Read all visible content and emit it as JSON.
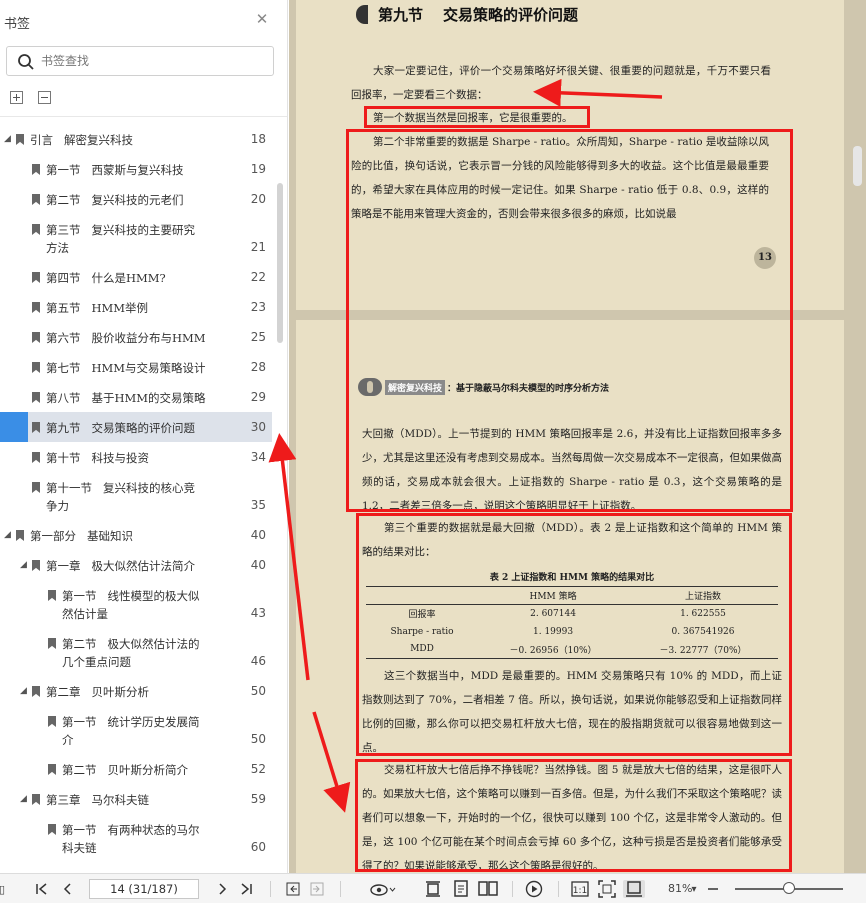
{
  "sidebar": {
    "title": "书签",
    "search_placeholder": "书签查找",
    "items": [
      {
        "label": "引言   解密复兴科技",
        "page": "18",
        "level": 0,
        "caret": true
      },
      {
        "label": "第一节   西蒙斯与复兴科技",
        "page": "19",
        "level": 1,
        "caret": false
      },
      {
        "label": "第二节   复兴科技的元老们",
        "page": "20",
        "level": 1,
        "caret": false
      },
      {
        "label": "第三节   复兴科技的主要研究\n方法",
        "page": "21",
        "level": 1,
        "caret": false
      },
      {
        "label": "第四节   什么是HMM?",
        "page": "22",
        "level": 1,
        "caret": false
      },
      {
        "label": "第五节   HMM举例",
        "page": "23",
        "level": 1,
        "caret": false
      },
      {
        "label": "第六节   股价收益分布与HMM",
        "page": "25",
        "level": 1,
        "caret": false
      },
      {
        "label": "第七节   HMM与交易策略设计",
        "page": "28",
        "level": 1,
        "caret": false
      },
      {
        "label": "第八节   基于HMM的交易策略",
        "page": "29",
        "level": 1,
        "caret": false
      },
      {
        "label": "第九节   交易策略的评价问题",
        "page": "30",
        "level": 1,
        "caret": false,
        "active": true
      },
      {
        "label": "第十节   科技与投资",
        "page": "34",
        "level": 1,
        "caret": false
      },
      {
        "label": "第十一节   复兴科技的核心竞\n争力",
        "page": "35",
        "level": 1,
        "caret": false
      },
      {
        "label": "第一部分   基础知识",
        "page": "40",
        "level": 0,
        "caret": true
      },
      {
        "label": "第一章   极大似然估计法简介",
        "page": "40",
        "level": 1,
        "caret": true
      },
      {
        "label": "第一节   线性模型的极大似\n然估计量",
        "page": "43",
        "level": 2,
        "caret": false
      },
      {
        "label": "第二节   极大似然估计法的\n几个重点问题",
        "page": "46",
        "level": 2,
        "caret": false
      },
      {
        "label": "第二章   贝叶斯分析",
        "page": "50",
        "level": 1,
        "caret": true
      },
      {
        "label": "第一节   统计学历史发展简\n介",
        "page": "50",
        "level": 2,
        "caret": false
      },
      {
        "label": "第二节   贝叶斯分析简介",
        "page": "52",
        "level": 2,
        "caret": false
      },
      {
        "label": "第三章   马尔科夫链",
        "page": "59",
        "level": 1,
        "caret": true
      },
      {
        "label": "第一节   有两种状态的马尔\n科夫链",
        "page": "60",
        "level": 2,
        "caret": false
      }
    ]
  },
  "document": {
    "page1": {
      "section_num": "第九节",
      "section_title": "交易策略的评价问题",
      "paragraphs": [
        "大家一定要记住，评价一个交易策略好坏很关键、很重要的问题就是，千万不要只看回报率，一定要看三个数据：",
        "第一个数据当然是回报率，它是很重要的。",
        "第二个非常重要的数据是 Sharpe - ratio。众所周知，Sharpe - ratio 是收益除以风险的比值，换句话说，它表示冒一分钱的风险能够得到多大的收益。这个比值是最最重要的，希望大家在具体应用的时候一定记住。如果 Sharpe - ratio 低于 0.8、0.9，这样的策略是不能用来管理大资金的，否则会带来很多很多的麻烦，比如说最"
      ],
      "page_number": "13"
    },
    "page2": {
      "banner_book": "解密复兴科技",
      "banner_subtitle": "：基于隐蔽马尔科夫模型的时序分析方法",
      "paragraphs": [
        "大回撤（MDD）。上一节提到的 HMM 策略回报率是 2.6，并没有比上证指数回报率多多少，尤其是这里还没有考虑到交易成本。当然每周做一次交易成本不一定很高，但如果做高频的话，交易成本就会很大。上证指数的 Sharpe - ratio 是 0.3，这个交易策略的是 1.2，二者差三倍多一点，说明这个策略明显好于上证指数。",
        "第三个重要的数据就是最大回撤（MDD）。表 2 是上证指数和这个简单的 HMM 策略的结果对比：",
        "这三个数据当中，MDD 是最重要的。HMM 交易策略只有 10% 的 MDD，而上证指数则达到了 70%，二者相差 7 倍。所以，换句话说，如果说你能够忍受和上证指数同样比例的回撤，那么你可以把交易杠杆放大七倍，现在的股指期货就可以很容易地做到这一点。",
        "交易杠杆放大七倍后挣不挣钱呢？当然挣钱。图 5 就是放大七倍的结果，这是很吓人的。如果放大七倍，这个策略可以赚到一百多倍。但是，为什么我们不采取这个策略呢？读者们可以想象一下，开始时的一个亿，很快可以赚到 100 个亿，这是非常令人激动的。但是，这 100 个亿可能在某个时间点会亏掉 60 多个亿，这种亏损是否是投资者们能够承受得了的？如果说能够承受，那么这个策略是很好的。"
      ],
      "table": {
        "caption": "表 2   上证指数和 HMM 策略的结果对比",
        "columns": [
          "",
          "HMM 策略",
          "上证指数"
        ],
        "rows": [
          [
            "回报率",
            "2. 607144",
            "1. 622555"
          ],
          [
            "Sharpe - ratio",
            "1. 19993",
            "0. 367541926"
          ],
          [
            "MDD",
            "－0. 26956（10%）",
            "－3. 22777（70%）"
          ]
        ]
      }
    }
  },
  "toolbar": {
    "page_display": "14  (31/187)",
    "zoom": "81%",
    "zoom_level": 0.5
  },
  "colors": {
    "highlight_box": "#ee1b1b",
    "active_row": "#dde2ea",
    "active_marker": "#3a8ee6",
    "page_background": "#e9e0c5"
  }
}
